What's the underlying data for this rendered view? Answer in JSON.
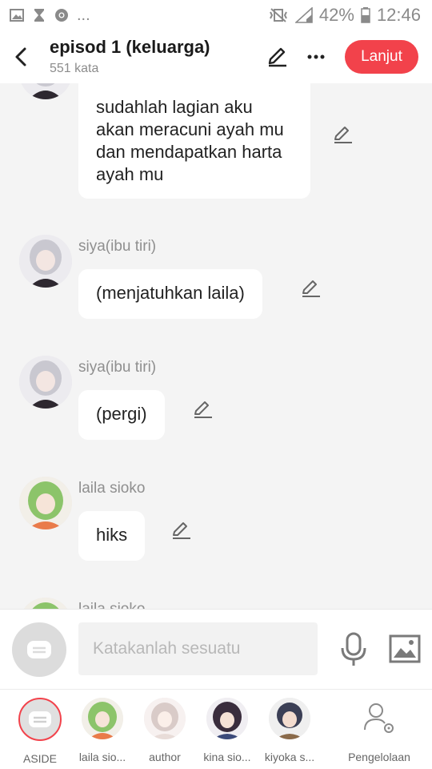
{
  "status_bar": {
    "dots": "...",
    "battery": "42%",
    "time": "12:46"
  },
  "header": {
    "title": "episod 1 (keluarga)",
    "word_count": "551 kata",
    "next_label": "Lanjut"
  },
  "messages": [
    {
      "speaker": "",
      "text": "sudahlah lagian aku akan meracuni ayah mu dan mendapatkan harta ayah mu",
      "avatar": "siya-avatar"
    },
    {
      "speaker": "siya(ibu tiri)",
      "text": "(menjatuhkan laila)",
      "avatar": "siya-avatar"
    },
    {
      "speaker": "siya(ibu tiri)",
      "text": "(pergi)",
      "avatar": "siya-avatar"
    },
    {
      "speaker": "laila sioko",
      "text": "hiks",
      "avatar": "laila-avatar"
    },
    {
      "speaker": "laila sioko",
      "text": "",
      "avatar": "laila-avatar"
    }
  ],
  "input": {
    "placeholder": "Katakanlah sesuatu"
  },
  "characters": [
    {
      "label": "ASIDE"
    },
    {
      "label": "laila sio..."
    },
    {
      "label": "author"
    },
    {
      "label": "kina sio..."
    },
    {
      "label": "kiyoka s..."
    },
    {
      "label": "Pengelolaan"
    }
  ],
  "colors": {
    "accent": "#f2424b",
    "background": "#f4f4f4",
    "bubble": "#ffffff"
  }
}
